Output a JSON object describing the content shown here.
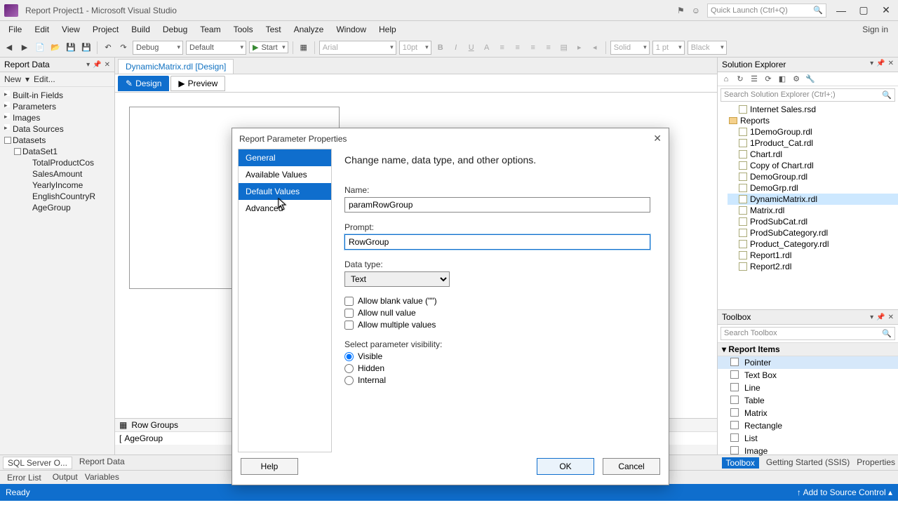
{
  "titlebar": {
    "title": "Report Project1 - Microsoft Visual Studio",
    "quicklaunch_placeholder": "Quick Launch (Ctrl+Q)"
  },
  "menu": [
    "File",
    "Edit",
    "View",
    "Project",
    "Build",
    "Debug",
    "Team",
    "Tools",
    "Test",
    "Analyze",
    "Window",
    "Help"
  ],
  "signin": "Sign in",
  "toolbar": {
    "config": "Debug",
    "platform": "Default",
    "start": "Start",
    "font": "Arial",
    "size": "10pt",
    "style": "Solid",
    "width": "1 pt",
    "color": "Black"
  },
  "report_data": {
    "title": "Report Data",
    "new": "New",
    "edit": "Edit...",
    "nodes": [
      "Built-in Fields",
      "Parameters",
      "Images",
      "Data Sources"
    ],
    "datasets": "Datasets",
    "dataset1": "DataSet1",
    "fields": [
      "TotalProductCos",
      "SalesAmount",
      "YearlyIncome",
      "EnglishCountryR",
      "AgeGroup"
    ]
  },
  "doc_tab": "DynamicMatrix.rdl [Design]",
  "design_tabs": {
    "design": "Design",
    "preview": "Preview"
  },
  "row_groups": {
    "title": "Row Groups",
    "item": "AgeGroup"
  },
  "dialog": {
    "title": "Report Parameter Properties",
    "nav": [
      "General",
      "Available Values",
      "Default Values",
      "Advanced"
    ],
    "heading": "Change name, data type, and other options.",
    "name_label": "Name:",
    "name_value": "paramRowGroup",
    "prompt_label": "Prompt:",
    "prompt_value": "RowGroup",
    "datatype_label": "Data type:",
    "datatype_value": "Text",
    "chk_blank": "Allow blank value (\"\")",
    "chk_null": "Allow null value",
    "chk_multi": "Allow multiple values",
    "vis_label": "Select parameter visibility:",
    "vis_visible": "Visible",
    "vis_hidden": "Hidden",
    "vis_internal": "Internal",
    "help": "Help",
    "ok": "OK",
    "cancel": "Cancel"
  },
  "solution_explorer": {
    "title": "Solution Explorer",
    "search_placeholder": "Search Solution Explorer (Ctrl+;)",
    "shared_ds": "Internet Sales.rsd",
    "reports_folder": "Reports",
    "reports": [
      "1DemoGroup.rdl",
      "1Product_Cat.rdl",
      "Chart.rdl",
      "Copy of Chart.rdl",
      "DemoGroup.rdl",
      "DemoGrp.rdl",
      "DynamicMatrix.rdl",
      "Matrix.rdl",
      "ProdSubCat.rdl",
      "ProdSubCategory.rdl",
      "Product_Category.rdl",
      "Report1.rdl",
      "Report2.rdl"
    ]
  },
  "toolbox": {
    "title": "Toolbox",
    "search_placeholder": "Search Toolbox",
    "group": "Report Items",
    "items": [
      "Pointer",
      "Text Box",
      "Line",
      "Table",
      "Matrix",
      "Rectangle",
      "List",
      "Image"
    ]
  },
  "right_bottom_tabs": [
    "Toolbox",
    "Getting Started (SSIS)",
    "Properties"
  ],
  "left_bottom_tabs": [
    "SQL Server O...",
    "Report Data"
  ],
  "bottom_tabs": [
    "Error List",
    "Output",
    "Variables"
  ],
  "status": {
    "ready": "Ready",
    "source": "Add to Source Control"
  }
}
